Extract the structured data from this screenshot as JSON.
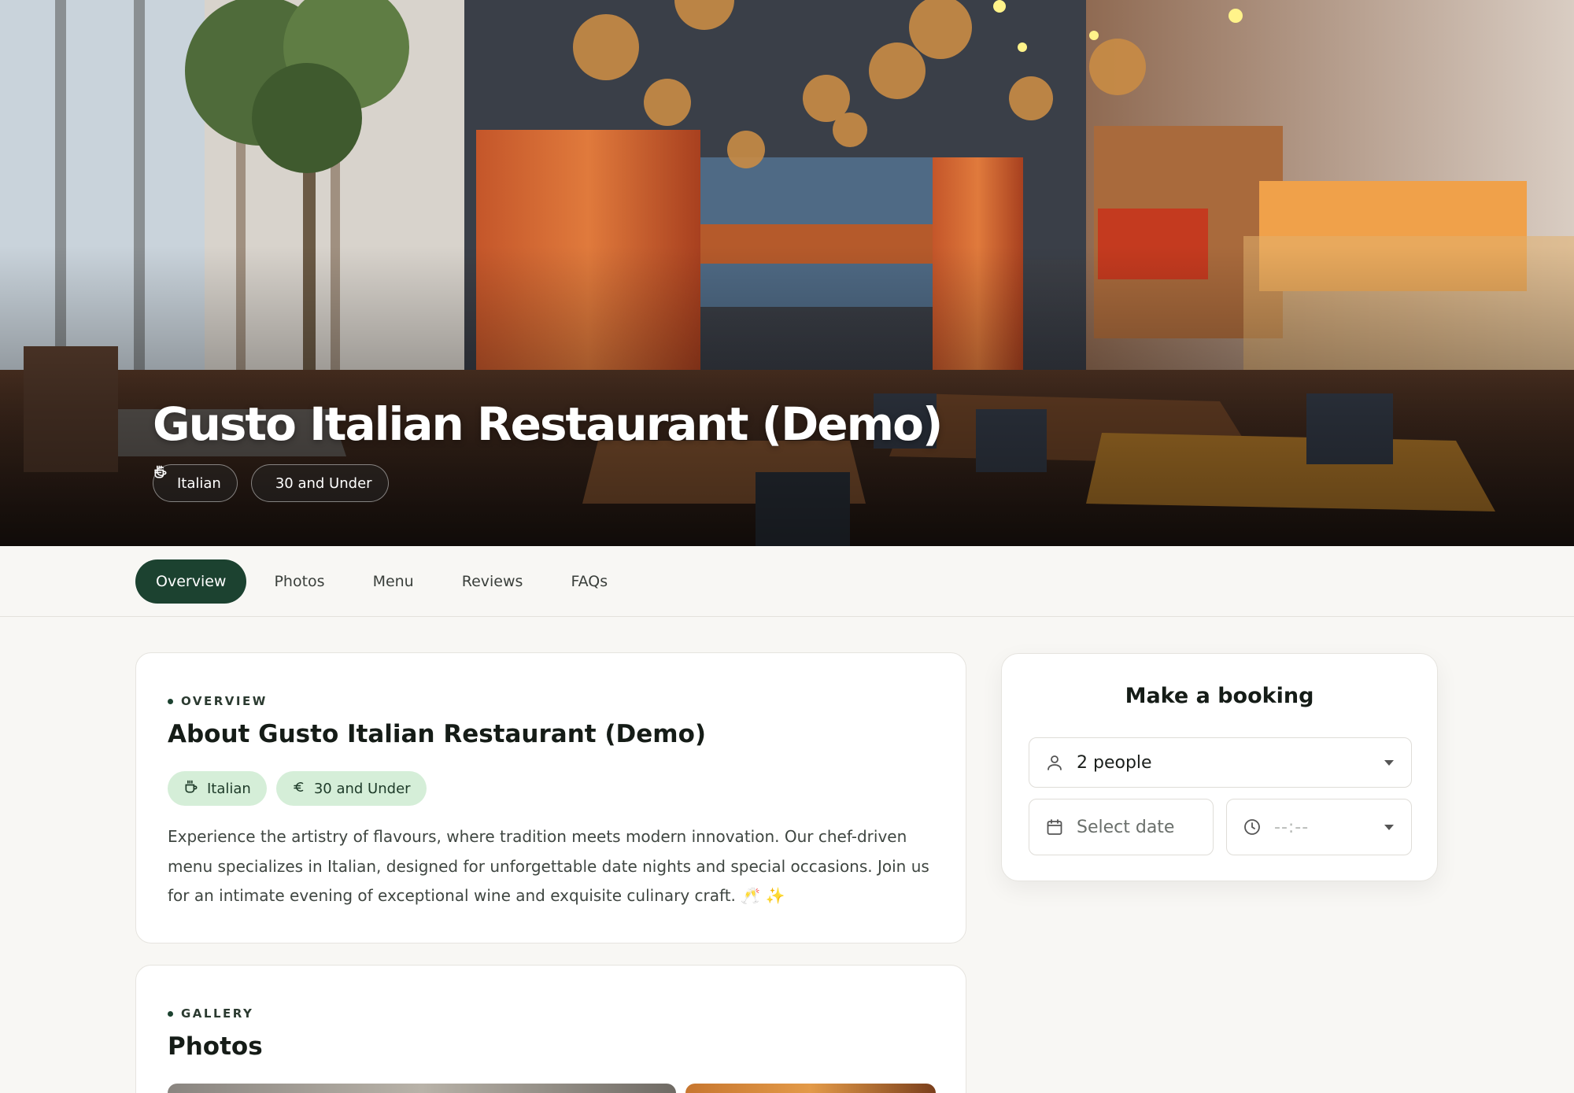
{
  "restaurant": {
    "name": "Gusto Italian Restaurant (Demo)",
    "cuisine": "Italian",
    "price": "30 and Under"
  },
  "hero": {
    "cuisine_icon": "coffee-cup-icon",
    "price_icon": "euro-icon"
  },
  "nav": {
    "tabs": [
      {
        "label": "Overview",
        "active": true
      },
      {
        "label": "Photos",
        "active": false
      },
      {
        "label": "Menu",
        "active": false
      },
      {
        "label": "Reviews",
        "active": false
      },
      {
        "label": "FAQs",
        "active": false
      }
    ]
  },
  "overview": {
    "eyebrow": "OVERVIEW",
    "title": "About Gusto Italian Restaurant (Demo)",
    "description": "Experience the artistry of flavours, where tradition meets modern innovation. Our chef-driven menu specializes in Italian, designed for unforgettable date nights and special occasions. Join us for an intimate evening of exceptional wine and exquisite culinary craft. 🥂 ✨"
  },
  "gallery": {
    "eyebrow": "GALLERY",
    "title": "Photos"
  },
  "booking": {
    "title": "Make a booking",
    "party_size": "2 people",
    "date_placeholder": "Select date",
    "time_placeholder": "--:--"
  },
  "colors": {
    "brand_green": "#1c4230",
    "tag_bg": "#d5eed8",
    "page_bg": "#f8f7f4"
  }
}
